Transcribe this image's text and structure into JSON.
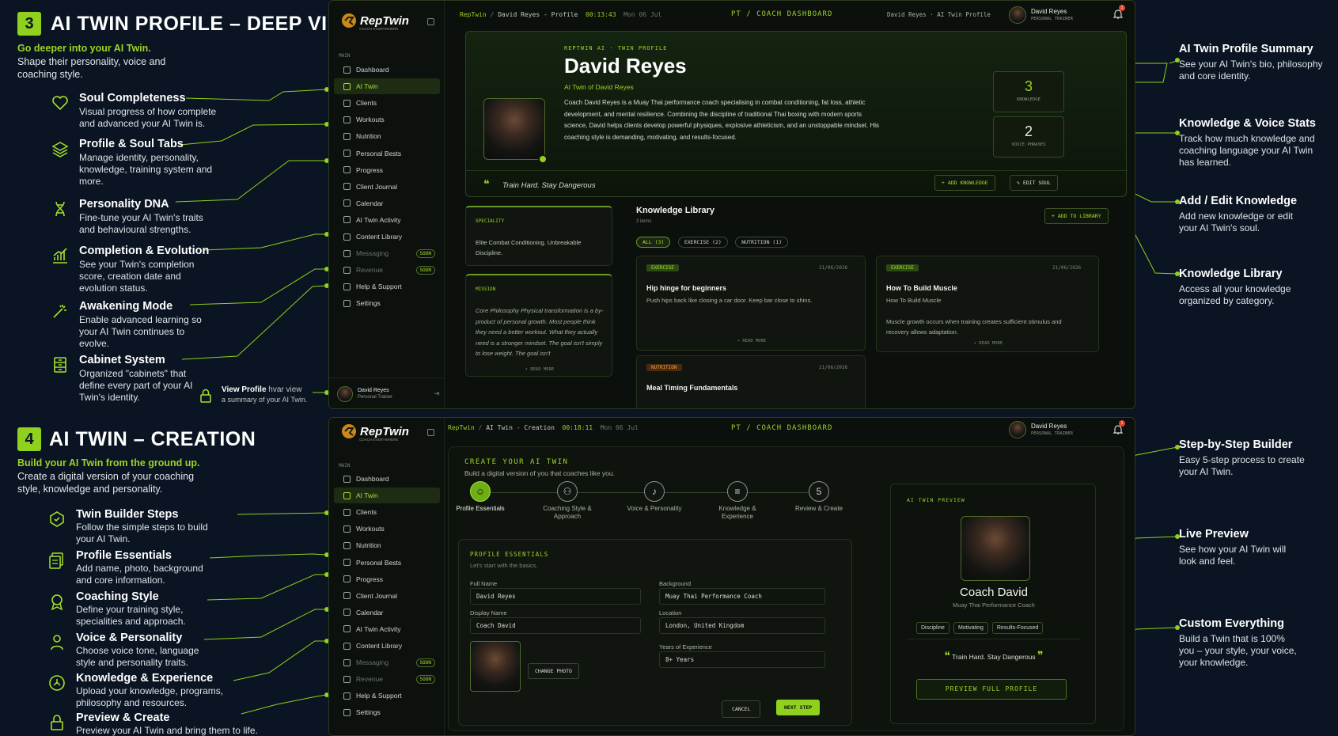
{
  "section3": {
    "num": "3",
    "title": "AI TWIN PROFILE – DEEP VIEW",
    "subtitle": "Go deeper into your AI Twin.",
    "desc": "Shape their personality, voice and coaching style.",
    "features": [
      {
        "icon": "heart-icon",
        "title": "Soul Completeness",
        "desc": "Visual progress of how complete and advanced your AI Twin is."
      },
      {
        "icon": "layers-icon",
        "title": "Profile & Soul Tabs",
        "desc": "Manage identity, personality, knowledge, training system and more."
      },
      {
        "icon": "dna-icon",
        "title": "Personality DNA",
        "desc": "Fine-tune your AI Twin's traits and behavioural strengths."
      },
      {
        "icon": "chart-icon",
        "title": "Completion & Evolution",
        "desc": "See your Twin's completion score, creation date and evolution status."
      },
      {
        "icon": "wand-icon",
        "title": "Awakening Mode",
        "desc": "Enable advanced learning so your AI Twin continues to evolve."
      },
      {
        "icon": "cabinet-icon",
        "title": "Cabinet System",
        "desc": "Organized \"cabinets\" that define every part of your AI Twin's identity."
      }
    ],
    "view_profile": {
      "title": "View Profile",
      "tail": "hvar view",
      "desc": "a summary of your AI Twin."
    },
    "right": [
      {
        "title": "AI Twin Profile Summary",
        "desc": "See your AI Twin's bio, philosophy and core identity."
      },
      {
        "title": "Knowledge & Voice Stats",
        "desc": "Track how much knowledge and coaching language your AI Twin has learned."
      },
      {
        "title": "Add / Edit Knowledge",
        "desc": "Add new knowledge or edit your AI Twin's soul."
      },
      {
        "title": "Knowledge Library",
        "desc": "Access all your knowledge organized by category."
      }
    ]
  },
  "section4": {
    "num": "4",
    "title": "AI TWIN – CREATION",
    "subtitle": "Build your AI Twin from the ground up.",
    "desc": "Create a digital version of your coaching style, knowledge and personality.",
    "features": [
      {
        "icon": "steps-icon",
        "title": "Twin Builder Steps",
        "desc": "Follow the simple steps to build your AI Twin."
      },
      {
        "icon": "essentials-icon",
        "title": "Profile Essentials",
        "desc": "Add name, photo, background and core information."
      },
      {
        "icon": "style-icon",
        "title": "Coaching Style",
        "desc": "Define your training style, specialities and approach."
      },
      {
        "icon": "voice-icon",
        "title": "Voice & Personality",
        "desc": "Choose voice tone, language style and personality traits."
      },
      {
        "icon": "knowledge-icon",
        "title": "Knowledge & Experience",
        "desc": "Upload your knowledge, programs, philosophy and resources."
      },
      {
        "icon": "lock-icon",
        "title": "Preview & Create",
        "desc": "Preview your AI Twin and bring them to life."
      }
    ],
    "right": [
      {
        "title": "Step-by-Step Builder",
        "desc": "Easy 5-step process to create your AI Twin."
      },
      {
        "title": "Live Preview",
        "desc": "See how your AI Twin will look and feel."
      },
      {
        "title": "Custom Everything",
        "desc": "Build a Twin that is 100% you – your style, your voice, your knowledge."
      }
    ]
  },
  "sidebar": {
    "logo": "RepTwin",
    "tagline": "COACH EVERYWHERE",
    "group": "MAIN",
    "items": [
      "Dashboard",
      "AI Twin",
      "Clients",
      "Workouts",
      "Nutrition",
      "Personal Bests",
      "Progress",
      "Client Journal",
      "Calendar",
      "AI Twin Activity",
      "Content Library",
      "Messaging",
      "Revenue",
      "Help & Support",
      "Settings"
    ],
    "soon": "SOON",
    "user_name": "David Reyes",
    "user_role": "Personal Trainer"
  },
  "screen1": {
    "crumb_app": "RepTwin",
    "crumb_page": "David Reyes - Profile",
    "time": "00:13:43",
    "date": "Mon 06 Jul",
    "center": "PT / COACH DASHBOARD",
    "right_crumb": "David Reyes · AI Twin Profile",
    "user": "David Reyes",
    "role": "PERSONAL TRAINER",
    "notif": "1",
    "eyebrow": "REPTWIN AI · TWIN PROFILE",
    "name": "David Reyes",
    "sub": "AI Twin of David Reyes",
    "bio": "Coach David Reyes is a Muay Thai performance coach specialising in combat conditioning, fat loss, athletic development, and mental resilience. Combining the discipline of traditional Thai boxing with modern sports science, David helps clients develop powerful physiques, explosive athleticism, and an unstoppable mindset. His coaching style is demanding, motivating, and results-focused.",
    "quote": "Train Hard. Stay Dangerous",
    "stat1_val": "3",
    "stat1_lbl": "KNOWLEDGE",
    "stat2_val": "2",
    "stat2_lbl": "VOICE PHRASES",
    "add_knowledge": "+ ADD KNOWLEDGE",
    "edit_soul": "EDIT SOUL",
    "speciality_lbl": "SPECIALITY",
    "speciality": "Elite Combat Conditioning. Unbreakable Discipline.",
    "mission_lbl": "MISSION",
    "mission": "Core Philosophy Physical transformation is a by-product of personal growth. Most people think they need a better workout. What they actually need is a stronger mindset. The goal isn't simply to lose weight. The goal isn't",
    "read_more": "READ MORE",
    "lib_title": "Knowledge Library",
    "lib_count": "3 items",
    "add_library": "+ ADD TO LIBRARY",
    "filters": [
      "ALL (3)",
      "EXERCISE (2)",
      "NUTRITION (1)"
    ],
    "cards": [
      {
        "tag": "EXERCISE",
        "date": "21/06/2026",
        "title": "Hip hinge for beginners",
        "sub": "Push hips back like closing a car door. Keep bar close to shins.",
        "body": ""
      },
      {
        "tag": "EXERCISE",
        "date": "21/06/2026",
        "title": "How To Build Muscle",
        "sub": "How To Build Muscle",
        "body": "Muscle growth occurs when training creates sufficient stimulus and recovery allows adaptation."
      },
      {
        "tag": "NUTRITION",
        "date": "21/06/2026",
        "title": "Meal Timing Fundamentals",
        "sub": "",
        "body": ""
      }
    ]
  },
  "screen2": {
    "crumb_app": "RepTwin",
    "crumb_page": "AI Twin - Creation",
    "time": "00:18:11",
    "date": "Mon 06 Jul",
    "center": "PT / COACH DASHBOARD",
    "user": "David Reyes",
    "role": "PERSONAL TRAINER",
    "notif": "1",
    "create_title": "CREATE YOUR AI TWIN",
    "create_sub": "Build a digital version of you that coaches like you.",
    "steps": [
      {
        "label": "Profile Essentials",
        "glyph": "☺"
      },
      {
        "label": "Coaching Style & Approach",
        "glyph": "⚇"
      },
      {
        "label": "Voice & Personality",
        "glyph": "♪"
      },
      {
        "label": "Knowledge & Experience",
        "glyph": "≡"
      },
      {
        "label": "Review & Create",
        "glyph": "5"
      }
    ],
    "pe_title": "PROFILE ESSENTIALS",
    "pe_sub": "Let's start with the basics.",
    "full_name_lbl": "Full Name",
    "full_name": "David Reyes",
    "display_name_lbl": "Display Name",
    "display_name": "Coach David",
    "background_lbl": "Background",
    "background": "Muay Thai Performance Coach",
    "location_lbl": "Location",
    "location": "London, United Kingdom",
    "years_lbl": "Years of Experience",
    "years": "8+ Years",
    "change_photo": "CHANGE PHOTO",
    "cancel": "CANCEL",
    "next": "NEXT STEP",
    "preview_lbl": "AI TWIN PREVIEW",
    "preview_name": "Coach David",
    "preview_role": "Muay Thai Performance Coach",
    "traits": [
      "Discipline",
      "Motivating",
      "Results-Focused"
    ],
    "preview_quote": "Train Hard. Stay Dangerous",
    "preview_btn": "PREVIEW FULL PROFILE"
  },
  "colors": {
    "accent": "#9bd425",
    "bg": "#0a1422",
    "panel": "#0c100c"
  }
}
